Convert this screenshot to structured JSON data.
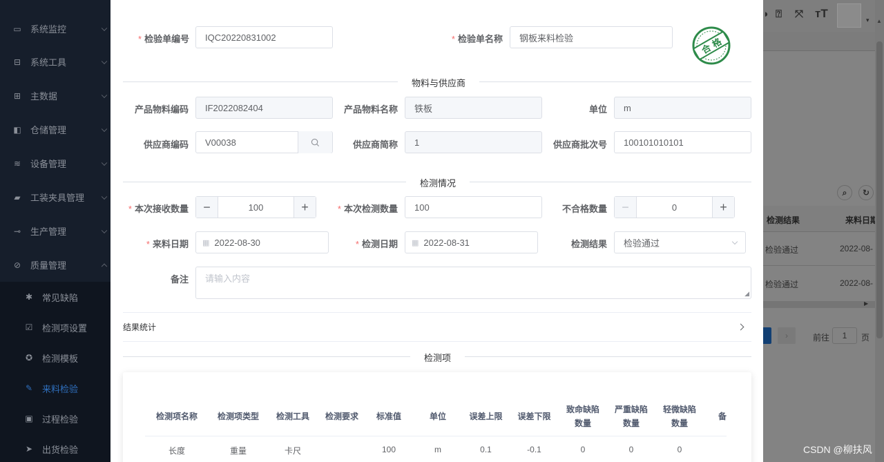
{
  "sidebar": {
    "items": [
      {
        "label": "系统监控",
        "icon": "monitor-icon"
      },
      {
        "label": "系统工具",
        "icon": "toolbox-icon"
      },
      {
        "label": "主数据",
        "icon": "table-icon"
      },
      {
        "label": "仓储管理",
        "icon": "warehouse-icon"
      },
      {
        "label": "设备管理",
        "icon": "layers-icon"
      },
      {
        "label": "工装夹具管理",
        "icon": "lock-icon"
      },
      {
        "label": "生产管理",
        "icon": "toggle-icon"
      },
      {
        "label": "质量管理",
        "icon": "quality-icon"
      }
    ],
    "subitems": [
      {
        "label": "常见缺陷",
        "icon": "bug-icon"
      },
      {
        "label": "检测项设置",
        "icon": "checkbox-icon"
      },
      {
        "label": "检测模板",
        "icon": "template-icon"
      },
      {
        "label": "来料检验",
        "icon": "edit-icon",
        "active": true
      },
      {
        "label": "过程检验",
        "icon": "process-icon"
      },
      {
        "label": "出货检验",
        "icon": "send-icon"
      }
    ]
  },
  "background": {
    "table_head_result": "检测结果",
    "table_head_date": "来料日期",
    "rows": [
      {
        "result": "检验通过",
        "date": "2022-08-"
      },
      {
        "result": "检验通过",
        "date": "2022-08-"
      }
    ],
    "goto_label": "前往",
    "page_value": "1",
    "page_unit": "页"
  },
  "form": {
    "code_label": "检验单编号",
    "code_value": "IQC20220831002",
    "name_label": "检验单名称",
    "name_value": "钢板来料检验",
    "stamp_text": "合格",
    "section_material": "物料与供应商",
    "item_code_label": "产品物料编码",
    "item_code_value": "IF2022082404",
    "item_name_label": "产品物料名称",
    "item_name_value": "铁板",
    "unit_label": "单位",
    "unit_value": "m",
    "vendor_code_label": "供应商编码",
    "vendor_code_value": "V00038",
    "vendor_name_label": "供应商简称",
    "vendor_name_value": "1",
    "vendor_batch_label": "供应商批次号",
    "vendor_batch_value": "100101010101",
    "section_check": "检测情况",
    "recv_qty_label": "本次接收数量",
    "recv_qty_value": "100",
    "check_qty_label": "本次检测数量",
    "check_qty_value": "100",
    "unqualified_label": "不合格数量",
    "unqualified_value": "0",
    "recv_date_label": "来料日期",
    "recv_date_value": "2022-08-30",
    "check_date_label": "检测日期",
    "check_date_value": "2022-08-31",
    "result_label": "检测结果",
    "result_value": "检验通过",
    "remark_label": "备注",
    "remark_placeholder": "请输入内容",
    "stats_label": "结果统计",
    "section_items": "检测项"
  },
  "table": {
    "headers": [
      "检测项名称",
      "检测项类型",
      "检测工具",
      "检测要求",
      "标准值",
      "单位",
      "误差上限",
      "误差下限",
      "致命缺陷\n数量",
      "严重缺陷\n数量",
      "轻微缺陷\n数量",
      "备"
    ],
    "rows": [
      [
        "长度",
        "重量",
        "卡尺",
        "",
        "100",
        "m",
        "0.1",
        "-0.1",
        "0",
        "0",
        "0",
        ""
      ]
    ]
  },
  "watermark": "CSDN @柳扶风"
}
